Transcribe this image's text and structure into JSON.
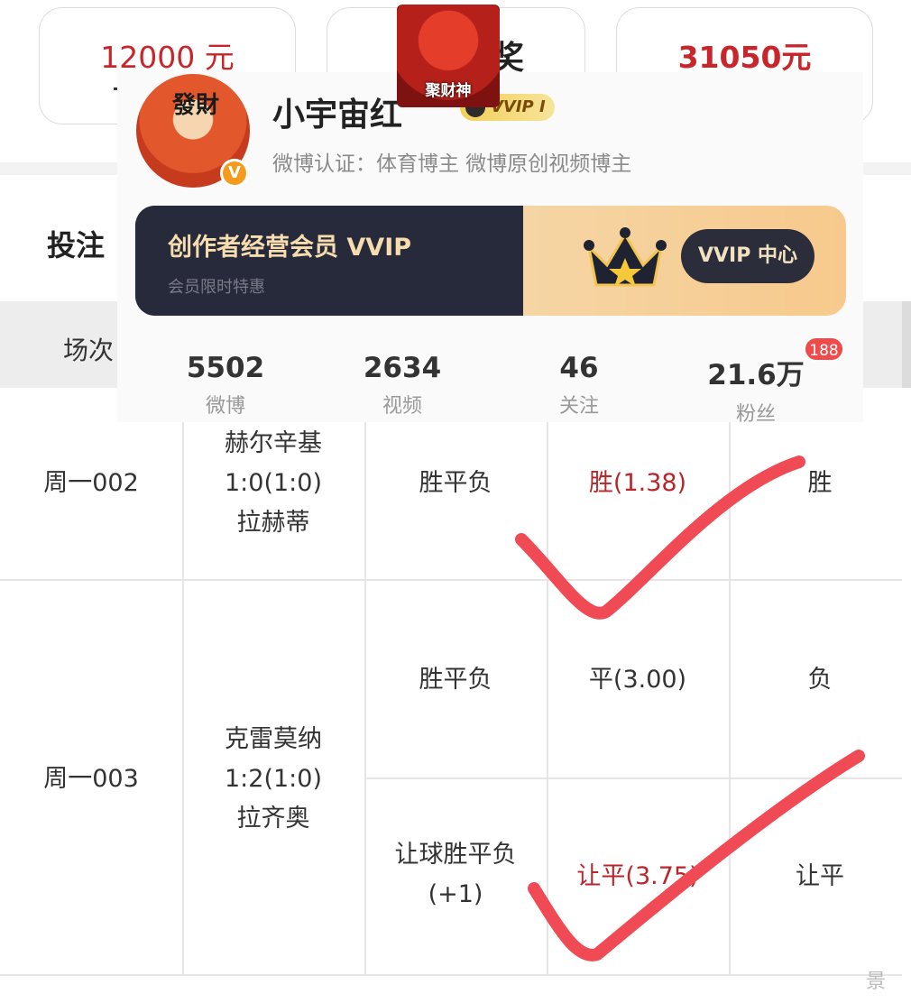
{
  "summary": {
    "card1_value": "12000 元",
    "card2_value": "奖",
    "card3_value": "31050元"
  },
  "section": {
    "title": "投注"
  },
  "table": {
    "header": {
      "col1": "场次"
    },
    "rows": [
      {
        "id": "周一002",
        "match": [
          "赫尔辛基",
          "1:0(1:0)",
          "拉赫蒂"
        ],
        "bets": [
          {
            "type": "胜平负",
            "pick": "胜(1.38)",
            "result": "胜"
          }
        ]
      },
      {
        "id": "周一003",
        "match": [
          "克雷莫纳",
          "1:2(1:0)",
          "拉齐奥"
        ],
        "bets": [
          {
            "type": "胜平负",
            "pick": "平(3.00)",
            "result": "负"
          },
          {
            "type": "让球胜平负",
            "type2": "(+1)",
            "pick": "让平(3.75)",
            "result": "让平"
          }
        ]
      }
    ]
  },
  "profile": {
    "name": "小宇宙红",
    "avatar_text": "發財",
    "vvip_level": "VVIP I",
    "verification": "微博认证：体育博主 微博原创视频博主",
    "sticker_text": "聚财神",
    "banner": {
      "title": "创作者经营会员 VVIP",
      "subtitle": "会员限时特惠",
      "button": "VVIP 中心"
    },
    "stats": [
      {
        "value": "5502",
        "label": "微博"
      },
      {
        "value": "2634",
        "label": "视频"
      },
      {
        "value": "46",
        "label": "关注"
      },
      {
        "value": "21.6万",
        "label": "粉丝"
      }
    ],
    "fan_badge": "188"
  },
  "corner_text": "景",
  "colors": {
    "accent_red": "#c8262b",
    "tick_red": "#f04a55",
    "banner_dark": "#262a3b",
    "banner_gold": "#f7c98c"
  }
}
